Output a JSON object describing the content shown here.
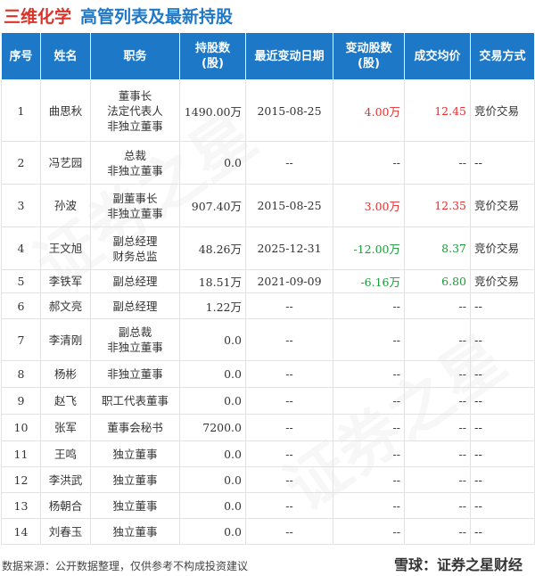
{
  "header": {
    "company": "三维化学",
    "subtitle": "高管列表及最新持股"
  },
  "columns": [
    "序号",
    "姓名",
    "职务",
    "持股数\n(股)",
    "最近变动日期",
    "变动股数\n(股)",
    "成交均价",
    "交易方式"
  ],
  "rows": [
    {
      "idx": "1",
      "name": "曲思秋",
      "role": "董事长\n法定代表人\n非独立董事",
      "shares": "1490.00万",
      "date": "2015-08-25",
      "change": "4.00万",
      "price": "12.45",
      "method": "竞价交易",
      "dir": "up"
    },
    {
      "idx": "2",
      "name": "冯艺园",
      "role": "总裁\n非独立董事",
      "shares": "0.0",
      "date": "--",
      "change": "--",
      "price": "--",
      "method": "--",
      "dir": "none"
    },
    {
      "idx": "3",
      "name": "孙波",
      "role": "副董事长\n非独立董事",
      "shares": "907.40万",
      "date": "2015-08-25",
      "change": "3.00万",
      "price": "12.35",
      "method": "竞价交易",
      "dir": "up"
    },
    {
      "idx": "4",
      "name": "王文旭",
      "role": "副总经理\n财务总监",
      "shares": "48.26万",
      "date": "2025-12-31",
      "change": "-12.00万",
      "price": "8.37",
      "method": "竞价交易",
      "dir": "down"
    },
    {
      "idx": "5",
      "name": "李铁军",
      "role": "副总经理",
      "shares": "18.51万",
      "date": "2021-09-09",
      "change": "-6.16万",
      "price": "6.80",
      "method": "竞价交易",
      "dir": "down"
    },
    {
      "idx": "6",
      "name": "郝文亮",
      "role": "副总经理",
      "shares": "1.22万",
      "date": "--",
      "change": "--",
      "price": "--",
      "method": "--",
      "dir": "none"
    },
    {
      "idx": "7",
      "name": "李清刚",
      "role": "副总裁\n非独立董事",
      "shares": "0.0",
      "date": "--",
      "change": "--",
      "price": "--",
      "method": "--",
      "dir": "none"
    },
    {
      "idx": "8",
      "name": "杨彬",
      "role": "非独立董事",
      "shares": "0.0",
      "date": "--",
      "change": "--",
      "price": "--",
      "method": "--",
      "dir": "none"
    },
    {
      "idx": "9",
      "name": "赵飞",
      "role": "职工代表董事",
      "shares": "0.0",
      "date": "--",
      "change": "--",
      "price": "--",
      "method": "--",
      "dir": "none"
    },
    {
      "idx": "10",
      "name": "张军",
      "role": "董事会秘书",
      "shares": "7200.0",
      "date": "--",
      "change": "--",
      "price": "--",
      "method": "--",
      "dir": "none"
    },
    {
      "idx": "11",
      "name": "王鸣",
      "role": "独立董事",
      "shares": "0.0",
      "date": "--",
      "change": "--",
      "price": "--",
      "method": "--",
      "dir": "none"
    },
    {
      "idx": "12",
      "name": "李洪武",
      "role": "独立董事",
      "shares": "0.0",
      "date": "--",
      "change": "--",
      "price": "--",
      "method": "--",
      "dir": "none"
    },
    {
      "idx": "13",
      "name": "杨朝合",
      "role": "独立董事",
      "shares": "0.0",
      "date": "--",
      "change": "--",
      "price": "--",
      "method": "--",
      "dir": "none"
    },
    {
      "idx": "14",
      "name": "刘春玉",
      "role": "独立董事",
      "shares": "0.0",
      "date": "--",
      "change": "--",
      "price": "--",
      "method": "--",
      "dir": "none"
    }
  ],
  "footer": {
    "source": "数据来源：公开数据整理，仅供参考不构成投资建议",
    "brand": "雪球：证券之星财经"
  },
  "colors": {
    "header_bg": "#1e78c8",
    "company": "#d9342b",
    "up": "#e62e2e",
    "down": "#1a9a3a"
  }
}
